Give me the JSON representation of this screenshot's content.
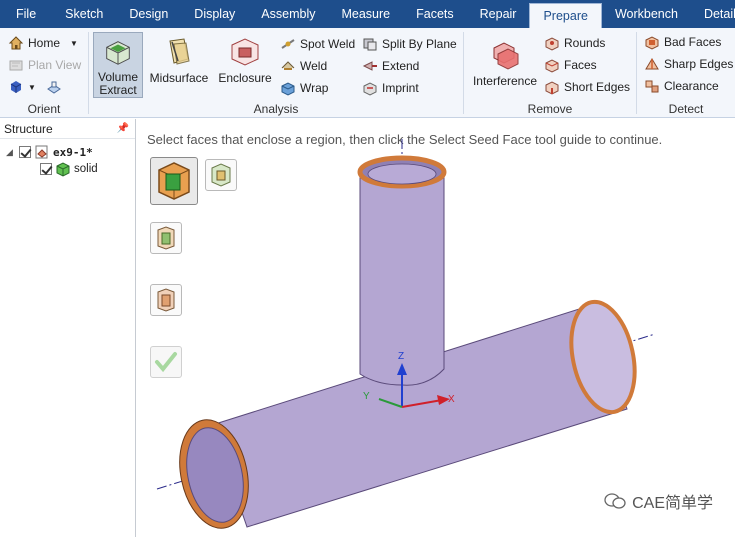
{
  "menu": {
    "tabs": [
      "File",
      "Sketch",
      "Design",
      "Display",
      "Assembly",
      "Measure",
      "Facets",
      "Repair",
      "Prepare",
      "Workbench",
      "Detail"
    ],
    "active_tab": "Prepare"
  },
  "ribbon": {
    "orient": {
      "label": "Orient",
      "home": "Home",
      "plan_view": "Plan View"
    },
    "analysis": {
      "label": "Analysis",
      "volume_extract_line1": "Volume",
      "volume_extract_line2": "Extract",
      "midsurface": "Midsurface",
      "enclosure": "Enclosure",
      "spot_weld": "Spot Weld",
      "weld": "Weld",
      "wrap": "Wrap",
      "split_by_plane": "Split By Plane",
      "extend": "Extend",
      "imprint": "Imprint"
    },
    "remove": {
      "label": "Remove",
      "interference": "Interference",
      "rounds": "Rounds",
      "faces": "Faces",
      "short_edges": "Short Edges"
    },
    "detect": {
      "label": "Detect",
      "bad_faces": "Bad Faces",
      "sharp_edges": "Sharp Edges",
      "clearance": "Clearance"
    }
  },
  "structure": {
    "title": "Structure",
    "root": "ex9-1*",
    "child": "solid"
  },
  "viewport": {
    "hint": "Select faces that enclose a region, then click the Select Seed Face tool guide to continue.",
    "axes": {
      "x": "X",
      "y": "Y",
      "z": "Z"
    },
    "watermark": "CAE简单学"
  },
  "colors": {
    "menubar": "#1e4e8c",
    "pipe_fill": "#b9a9d6",
    "pipe_rim": "#d07a3a",
    "axis_x": "#d0202a",
    "axis_y": "#2a9a3a",
    "axis_z": "#2040d0"
  }
}
